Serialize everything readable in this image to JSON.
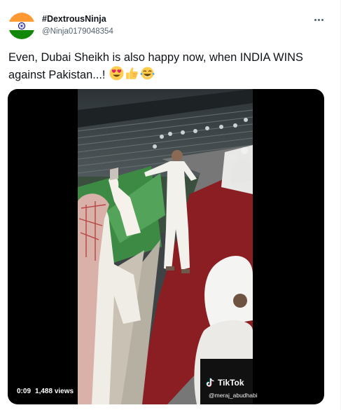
{
  "tweet": {
    "display_name": "#DextrousNinja",
    "handle": "@Ninja0179048354",
    "text": "Even, Dubai Sheikh is also happy now, when INDIA WINS against Pakistan...!",
    "emojis": [
      "heart-eyes-emoji",
      "thumbs-up-emoji",
      "tears-of-joy-emoji"
    ],
    "more_icon": "more-icon"
  },
  "video": {
    "time": "0:09",
    "views": "1,488 views",
    "watermark_brand": "TikTok",
    "watermark_user": "@meraj_abudhabi"
  },
  "colors": {
    "text_primary": "#0f1419",
    "text_secondary": "#536471",
    "flag_saffron": "#ff9933",
    "flag_green": "#138808",
    "flag_chakra": "#000080",
    "carpet_red": "#8f1d22"
  }
}
